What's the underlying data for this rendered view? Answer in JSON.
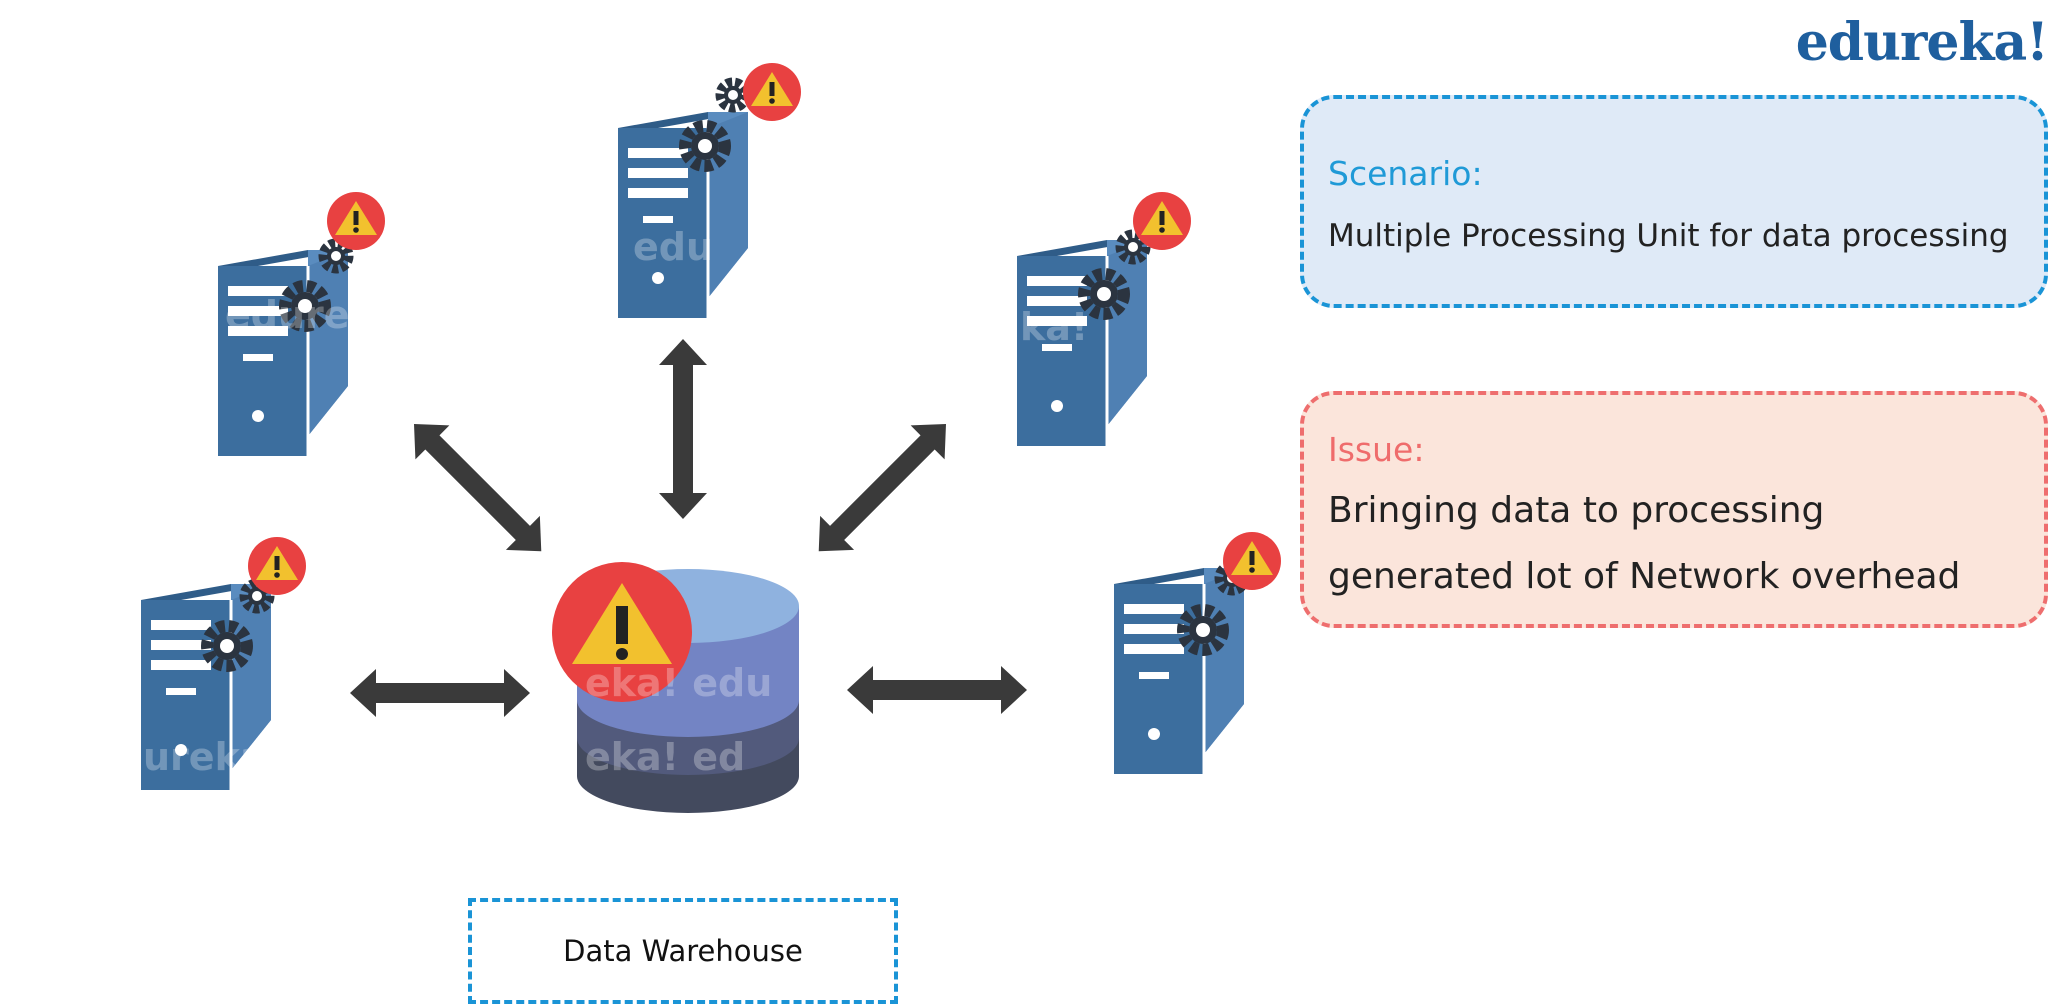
{
  "brand": {
    "logo": "edureka!"
  },
  "scenario": {
    "heading": "Scenario:",
    "text": "Multiple Processing Unit for data processing"
  },
  "issue": {
    "heading": "Issue:",
    "text": "Bringing data to processing generated lot of Network overhead"
  },
  "data_warehouse": {
    "label": "Data Warehouse"
  },
  "colors": {
    "server_front": "#3c6e9e",
    "server_side": "#5a8cbf",
    "gear": "#2b3440",
    "alert_circle": "#e84141",
    "alert_triangle": "#f2c12e",
    "arrow": "#3a3a3a",
    "db_top": "#8fb2df",
    "db_layer2": "#7384c4",
    "db_layer3": "#525a7c",
    "db_bottom": "#434a5e",
    "scenario_border": "#1a94d6",
    "issue_border": "#ee6e6e"
  },
  "icons": [
    "server-icon",
    "gear-icon",
    "warning-icon",
    "database-icon",
    "double-arrow-icon"
  ]
}
